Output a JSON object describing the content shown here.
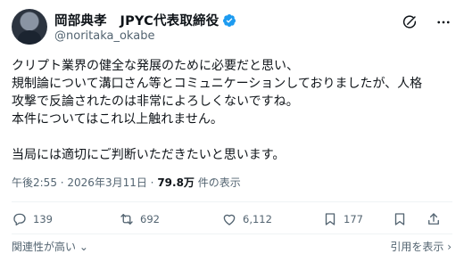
{
  "author": {
    "display_name": "岡部典孝　JPYC代表取締役",
    "handle": "@noritaka_okabe",
    "verified": true
  },
  "post": {
    "lines": [
      "クリプト業界の健全な発展のために必要だと思い、",
      "規制論について溝口さん等とコミュニケーションしておりましたが、人格",
      "攻撃で反論されたのは非常によろしくないですね。",
      "本件についてはこれ以上触れません。",
      "",
      "当局には適切にご判断いただきたいと思います。"
    ]
  },
  "meta": {
    "time": "午後2:55",
    "separator": " · ",
    "date": "2026年3月11日",
    "views_count": "79.8万",
    "views_label": " 件の表示"
  },
  "actions": {
    "replies": "139",
    "reposts": "692",
    "likes": "6,112",
    "bookmarks": "177"
  },
  "footer": {
    "relevance_label": "関連性が高い",
    "quotes_label": "引用を表示"
  },
  "colors": {
    "verified_blue": "#1d9bf0",
    "muted_text": "#536471",
    "main_text": "#0f1419"
  },
  "icons": [
    "grok-icon",
    "more-icon",
    "reply-icon",
    "repost-icon",
    "like-icon",
    "views-icon",
    "bookmark-icon",
    "share-icon",
    "verified-badge-icon",
    "chevron-down-icon",
    "chevron-right-icon"
  ]
}
